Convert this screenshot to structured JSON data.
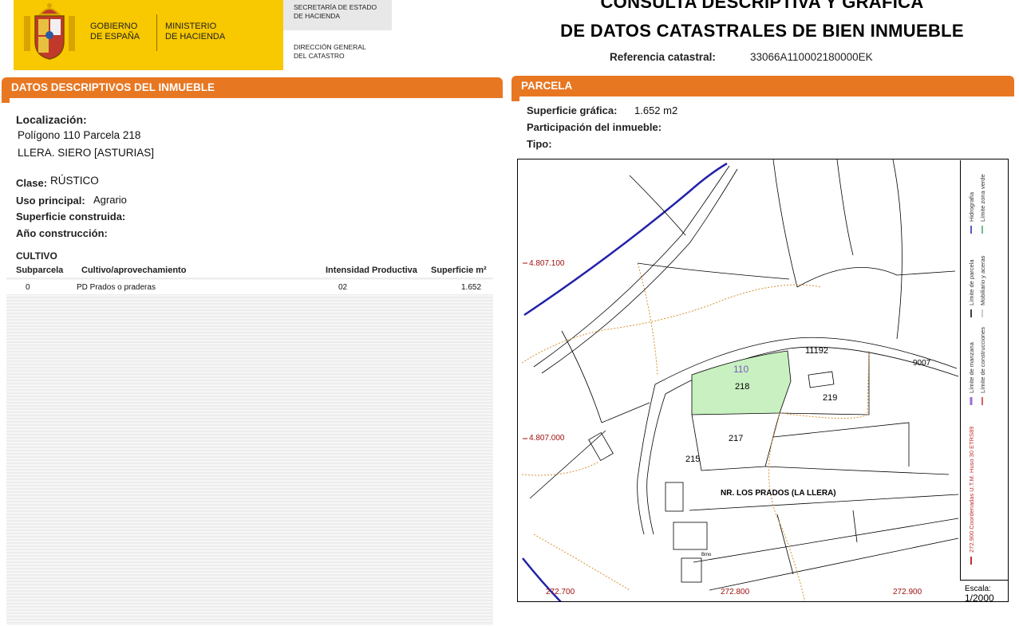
{
  "header": {
    "gov_line1": "GOBIERNO",
    "gov_line2": "DE ESPAÑA",
    "min_line1": "MINISTERIO",
    "min_line2": "DE HACIENDA",
    "sec_line1": "SECRETARÍA DE ESTADO",
    "sec_line2": "DE HACIENDA",
    "dir_line1": "DIRECCIÓN GENERAL",
    "dir_line2": "DEL CATASTRO",
    "title_line1": "CONSULTA DESCRIPTIVA Y GRÁFICA",
    "title_line2": "DE DATOS CATASTRALES DE BIEN INMUEBLE",
    "ref_label": "Referencia catastral:",
    "ref_value": "33066A110002180000EK",
    "logo_color": "#f8c800"
  },
  "left": {
    "section_title": "DATOS DESCRIPTIVOS DEL INMUEBLE",
    "loc_label": "Localización:",
    "loc_line1": "Polígono 110 Parcela 218",
    "loc_line2": "LLERA. SIERO [ASTURIAS]",
    "clase_label": "Clase:",
    "clase_value": "RÚSTICO",
    "uso_label": "Uso principal:",
    "uso_value": "Agrario",
    "sup_label": "Superficie construida:",
    "anio_label": "Año construcción:",
    "cultivo_title": "CULTIVO",
    "columns": [
      "Subparcela",
      "Cultivo/aprovechamiento",
      "Intensidad Productiva",
      "Superficie m²"
    ],
    "rows": [
      {
        "subparcela": "0",
        "cultivo": "PD Prados o praderas",
        "intensidad": "02",
        "superficie": "1.652"
      }
    ]
  },
  "right": {
    "section_title": "PARCELA",
    "sup_label": "Superficie gráfica:",
    "sup_value": "1.652 m2",
    "part_label": "Participación del inmueble:",
    "tipo_label": "Tipo:",
    "accent_color": "#e87722"
  },
  "map": {
    "coord_y1": "4.807.100",
    "coord_y2": "4.807.000",
    "coord_x1": "272.700",
    "coord_x2": "272.800",
    "coord_x3": "272.900",
    "poligono": "110",
    "parcela_main": "218",
    "parcela_217": "217",
    "parcela_219": "219",
    "parcela_215": "215",
    "parcela_11192": "11192",
    "road_9007": "9007",
    "place": "NR. LOS PRADOS (LA LLERA)",
    "small_label": "Bmo",
    "scale_label": "Escala:",
    "scale_value": "1/2000",
    "legend_coords": "272.900 Coordenadas U.T.M. Huso 30 ETRS89",
    "legend_manzana": "Límite de manzana",
    "legend_construcciones": "Límite de construcciones",
    "legend_parcela": "Límite de parcela",
    "legend_mobiliario": "Mobiliario y aceras",
    "legend_hidrografia": "Hidrografía",
    "legend_zona_verde": "Límite zona verde",
    "parcel_fill": "#c8f0c0"
  }
}
